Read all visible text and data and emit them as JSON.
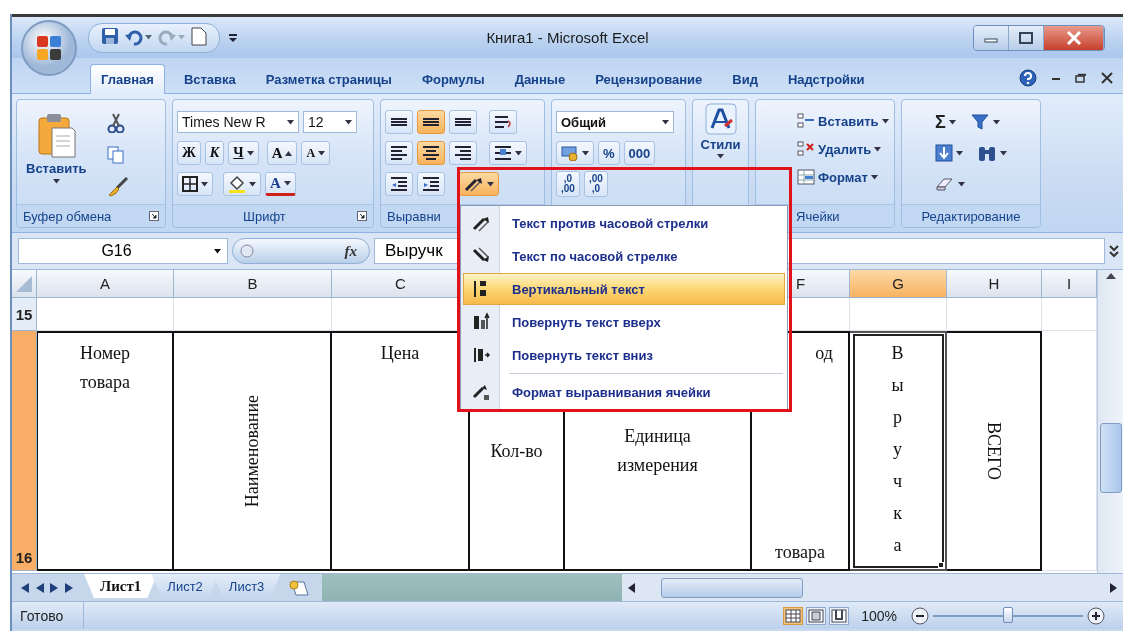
{
  "window": {
    "title": "Книга1 - Microsoft Excel"
  },
  "tabs": [
    {
      "label": "Главная",
      "selected": true
    },
    {
      "label": "Вставка",
      "selected": false
    },
    {
      "label": "Разметка страницы",
      "selected": false
    },
    {
      "label": "Формулы",
      "selected": false
    },
    {
      "label": "Данные",
      "selected": false
    },
    {
      "label": "Рецензирование",
      "selected": false
    },
    {
      "label": "Вид",
      "selected": false
    },
    {
      "label": "Надстройки",
      "selected": false
    }
  ],
  "ribbon": {
    "clipboard": {
      "paste": "Вставить",
      "label": "Буфер обмена"
    },
    "font": {
      "name": "Times New R",
      "size": "12",
      "bold": "Ж",
      "italic": "К",
      "underline": "Ч",
      "grow": "A",
      "shrink": "A",
      "font_color": "A",
      "label": "Шрифт"
    },
    "alignment": {
      "buttons": [
        {
          "on": false
        },
        {
          "on": true
        },
        {
          "on": false
        },
        {
          "on": false
        },
        {
          "on": false
        },
        {
          "on": true
        },
        {
          "on": false
        },
        {
          "on": false
        },
        {
          "on": false
        },
        {
          "on": false
        },
        {
          "on": true
        }
      ],
      "label": "Выравни"
    },
    "number": {
      "format": "Общий",
      "percent": "%",
      "thousands": "000",
      "decimals": [
        {
          "top": ",0",
          "bottom": ",00"
        },
        {
          "top": ",00",
          "bottom": ",0"
        }
      ]
    },
    "styles": {
      "label": "Стили"
    },
    "cells": {
      "buttons": [
        "Вставить",
        "Удалить",
        "Формат"
      ],
      "label": "Ячейки"
    },
    "editing": {
      "sum": "Σ",
      "label": "Редактирование"
    }
  },
  "formula_bar": {
    "cell": "G16",
    "fx": "fx",
    "content": "Выручк"
  },
  "columns": [
    {
      "label": "A",
      "selected": false
    },
    {
      "label": "B",
      "selected": false
    },
    {
      "label": "C",
      "selected": false
    },
    {},
    {},
    {
      "label": "F",
      "selected": false
    },
    {
      "label": "G",
      "selected": true
    },
    {
      "label": "H",
      "selected": false
    },
    {
      "label": "I",
      "selected": false
    }
  ],
  "rows": [
    {
      "number": "15",
      "selected": false
    },
    {
      "number": "16",
      "selected": true,
      "cells": [
        {
          "kind": "top",
          "text": "Номер\nтовара",
          "selected": false
        },
        {
          "kind": "up",
          "text": "Наименование",
          "selected": false
        },
        {
          "kind": "top",
          "text": "Цена",
          "selected": false
        },
        {
          "kind": "middle",
          "text": "Кол-во",
          "selected": false
        },
        {
          "kind": "middle",
          "text": "Единица\nизмерения",
          "selected": false
        },
        {
          "kind": "split",
          "text": "од\nтовара",
          "selected": false
        },
        {
          "kind": "stacked",
          "text": "Выручка",
          "selected": true
        },
        {
          "kind": "down",
          "text": "ВСЕГО",
          "selected": false
        }
      ]
    }
  ],
  "menu": {
    "items": [
      {
        "label": "Текст против часовой стрелки",
        "selected": false
      },
      {
        "label": "Текст по часовой стрелке",
        "selected": false
      },
      {
        "label": "Вертикальный текст",
        "selected": true
      },
      {
        "label": "Повернуть текст вверх",
        "selected": false
      },
      {
        "label": "Повернуть текст вниз",
        "selected": false
      },
      {
        "label": "Формат выравнивания ячейки",
        "selected": false
      }
    ]
  },
  "sheets": [
    {
      "label": "Лист1",
      "selected": true
    },
    {
      "label": "Лист2",
      "selected": false
    },
    {
      "label": "Лист3",
      "selected": false
    }
  ],
  "status_bar": {
    "text": "Готово",
    "zoom": "100%",
    "zoom_slider": {
      "level": 0.5
    }
  }
}
